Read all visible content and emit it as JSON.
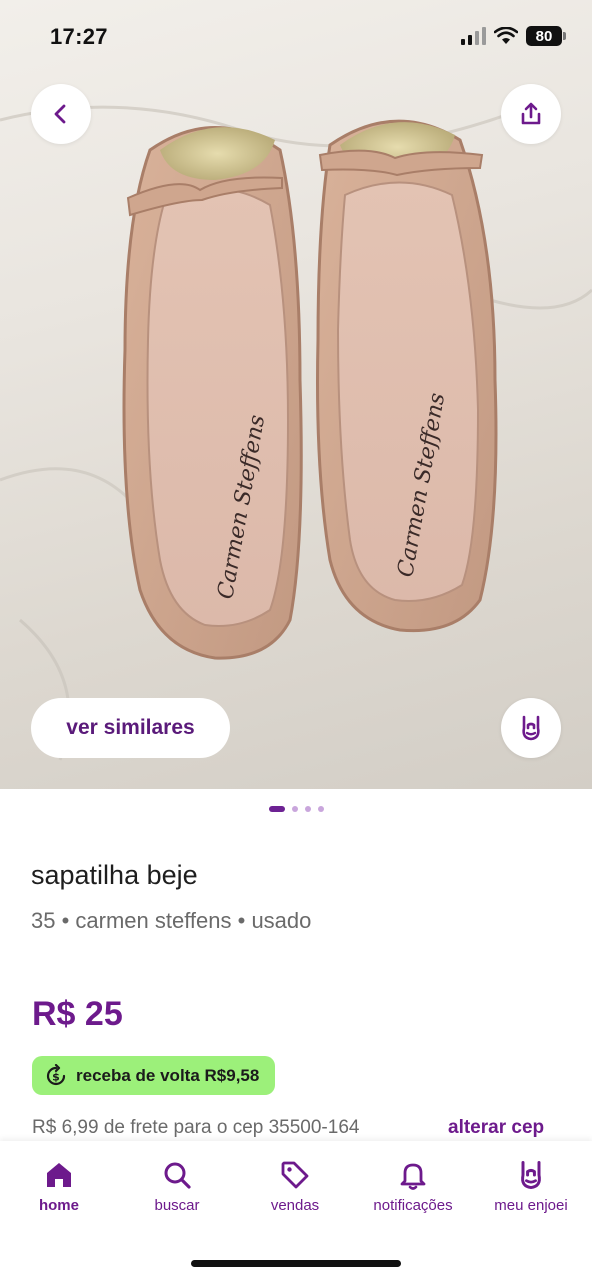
{
  "status_bar": {
    "time": "17:27",
    "battery": "80"
  },
  "hero": {
    "similar_label": "ver similares",
    "image_count": 4,
    "active_image": 1
  },
  "product": {
    "title": "sapatilha beje",
    "meta": "35 • carmen steffens • usado",
    "price": "R$ 25",
    "cashback": "receba de volta R$9,58",
    "shipping": "R$ 6,99 de frete para o cep 35500-164",
    "change_cep": "alterar cep",
    "insole_brand": "Carmen Steffens"
  },
  "tabs": [
    {
      "label": "home",
      "icon": "home-icon",
      "active": true
    },
    {
      "label": "buscar",
      "icon": "search-icon",
      "active": false
    },
    {
      "label": "vendas",
      "icon": "tag-icon",
      "active": false
    },
    {
      "label": "notificações",
      "icon": "bell-icon",
      "active": false
    },
    {
      "label": "meu enjoei",
      "icon": "rock-hand-icon",
      "active": false
    }
  ],
  "colors": {
    "brand": "#6d1a8c",
    "cashback_bg": "#9cf07a",
    "pager_inactive": "#c9a6dc"
  }
}
